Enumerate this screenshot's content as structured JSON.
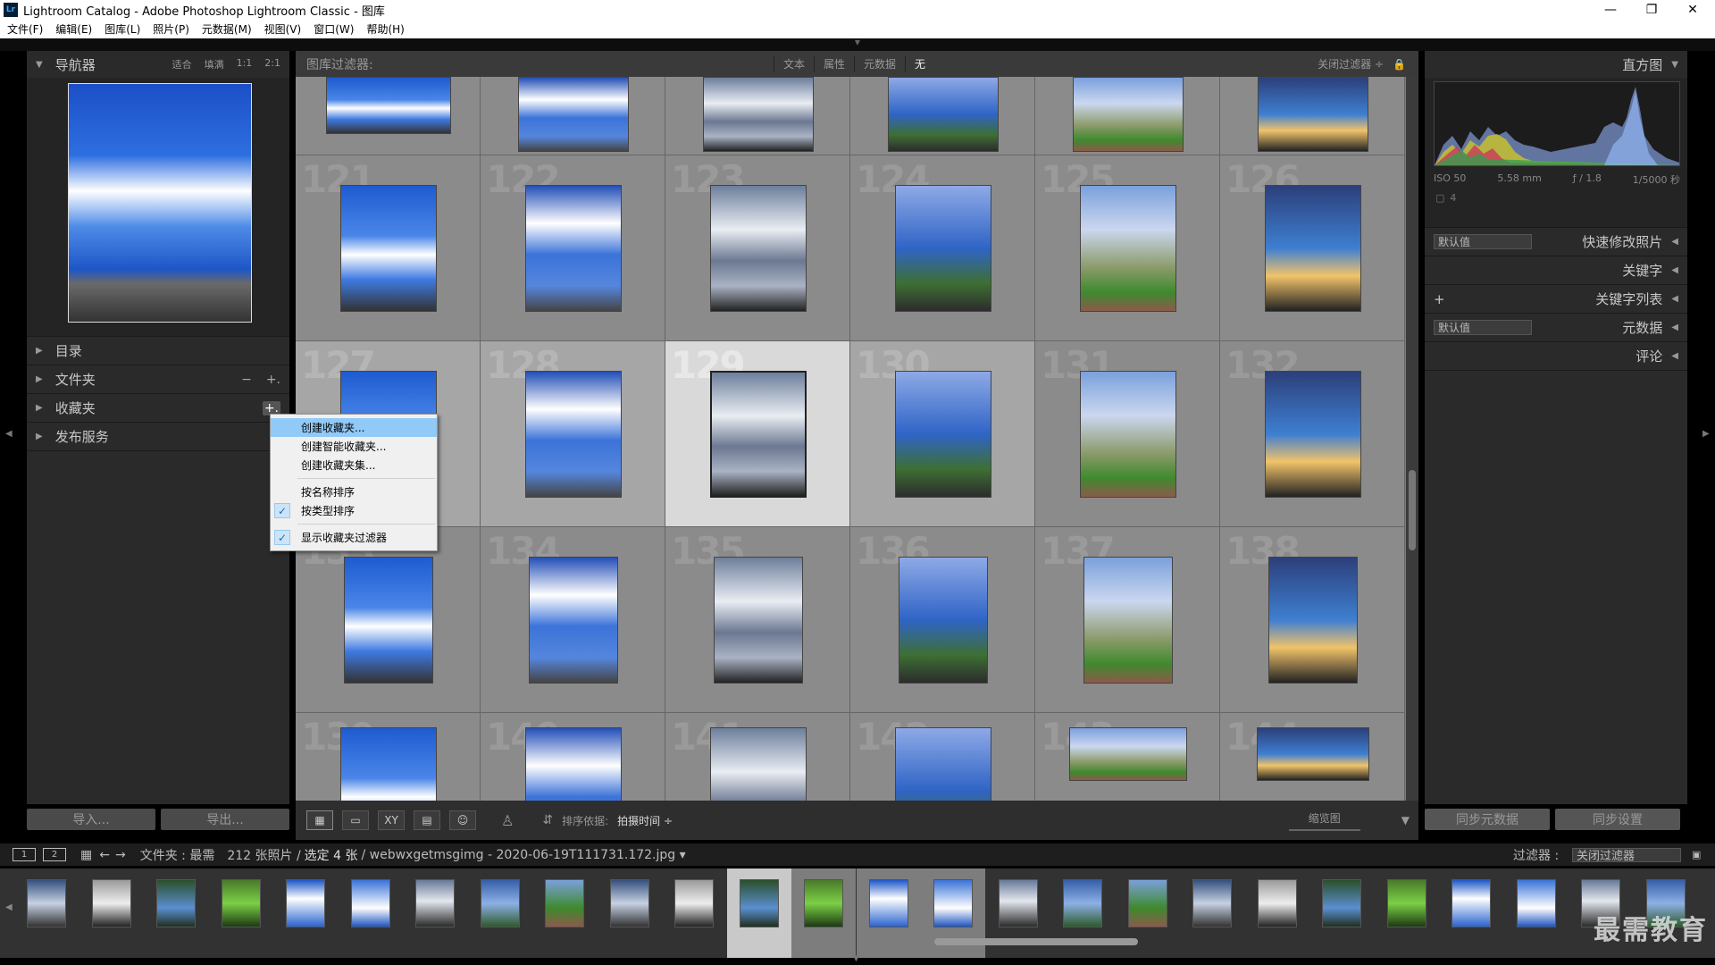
{
  "window": {
    "title": "Lightroom Catalog - Adobe Photoshop Lightroom Classic - 图库",
    "app_badge": "Lr"
  },
  "menu": [
    "文件(F)",
    "编辑(E)",
    "图库(L)",
    "照片(P)",
    "元数据(M)",
    "视图(V)",
    "窗口(W)",
    "帮助(H)"
  ],
  "left": {
    "navigator": {
      "title": "导航器",
      "options": [
        "适合",
        "填满",
        "1:1",
        "2:1"
      ]
    },
    "panels": [
      {
        "label": "目录"
      },
      {
        "label": "文件夹",
        "icons": [
          "−",
          "+."
        ]
      },
      {
        "label": "收藏夹",
        "icons": [
          "+."
        ]
      },
      {
        "label": "发布服务"
      }
    ],
    "import_label": "导入...",
    "export_label": "导出..."
  },
  "context_menu": {
    "items": [
      {
        "label": "创建收藏夹...",
        "highlighted": true,
        "checked": false
      },
      {
        "label": "创建智能收藏夹...",
        "highlighted": false,
        "checked": false
      },
      {
        "label": "创建收藏夹集...",
        "highlighted": false,
        "checked": false
      },
      {
        "label": "按名称排序",
        "highlighted": false,
        "checked": false
      },
      {
        "label": "按类型排序",
        "highlighted": false,
        "checked": true
      },
      {
        "label": "显示收藏夹过滤器",
        "highlighted": false,
        "checked": true
      }
    ]
  },
  "filter_bar": {
    "title": "图库过滤器:",
    "tabs": [
      "文本",
      "属性",
      "元数据",
      "无"
    ],
    "preset": "关闭过滤器 ÷"
  },
  "grid": {
    "rows": [
      {
        "numbers": [
          "",
          "",
          "",
          "",
          "",
          ""
        ],
        "selected": [
          0,
          0,
          0,
          0,
          0,
          0
        ]
      },
      {
        "numbers": [
          "121",
          "122",
          "123",
          "124",
          "125",
          "126"
        ],
        "selected": [
          0,
          0,
          0,
          0,
          0,
          0
        ]
      },
      {
        "numbers": [
          "127",
          "128",
          "129",
          "130",
          "131",
          "132"
        ],
        "selected": [
          1,
          1,
          2,
          1,
          0,
          0
        ]
      },
      {
        "numbers": [
          "133",
          "134",
          "135",
          "136",
          "137",
          "138"
        ],
        "selected": [
          0,
          0,
          0,
          0,
          0,
          0
        ]
      },
      {
        "numbers": [
          "139",
          "140",
          "141",
          "142",
          "143",
          "144"
        ],
        "selected": [
          0,
          0,
          0,
          0,
          0,
          0
        ]
      }
    ]
  },
  "toolbar": {
    "sort_label": "排序依据:",
    "sort_value": "拍摄时间 ÷",
    "thumb_label": "缩览图"
  },
  "right": {
    "histogram": {
      "title": "直方图",
      "iso": "ISO 50",
      "focal": "5.58 mm",
      "aperture": "ƒ / 1.8",
      "shutter": "1/5000 秒",
      "count": "4"
    },
    "rows": [
      {
        "select": "默认值",
        "label": "快速修改照片"
      },
      {
        "label": "关键字"
      },
      {
        "plus": "+",
        "label": "关键字列表"
      },
      {
        "select": "默认值",
        "label": "元数据"
      },
      {
        "label": "评论"
      }
    ],
    "sync_meta": "同步元数据",
    "sync_settings": "同步设置"
  },
  "filmstrip_bar": {
    "screen1": "1",
    "screen2": "2",
    "source": "文件夹 : 最需",
    "count": "212 张照片 /",
    "selected": "选定 4 张",
    "file": "/ webwxgetmsgimg - 2020-06-19T111731.172.jpg ▾",
    "filter_label": "过滤器 :",
    "filter_value": "关闭过滤器"
  },
  "watermark": "最需教育",
  "palette": {
    "accent_highlight": "#91c9f7",
    "panel_bg": "#2a2a2a",
    "grid_bg": "#8b8b8b"
  }
}
